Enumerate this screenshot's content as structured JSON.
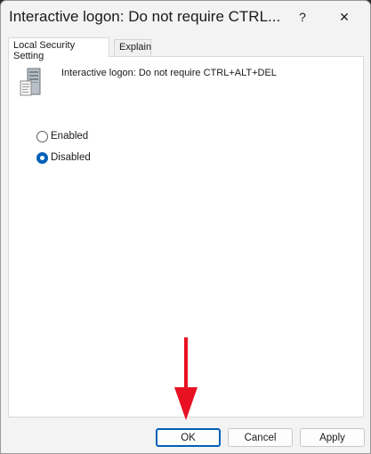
{
  "window": {
    "title": "Interactive logon: Do not require CTRL...",
    "help_glyph": "?",
    "close_glyph": "✕"
  },
  "tabs": [
    {
      "label": "Local Security Setting",
      "active": true
    },
    {
      "label": "Explain",
      "active": false
    }
  ],
  "policy": {
    "icon": "server-policy-icon",
    "name": "Interactive logon: Do not require CTRL+ALT+DEL"
  },
  "options": [
    {
      "label": "Enabled",
      "checked": false
    },
    {
      "label": "Disabled",
      "checked": true
    }
  ],
  "annotation": {
    "icon": "red-arrow-down-icon",
    "color": "#e81123"
  },
  "buttons": {
    "ok": "OK",
    "cancel": "Cancel",
    "apply": "Apply"
  },
  "colors": {
    "accent": "#005fb8"
  }
}
